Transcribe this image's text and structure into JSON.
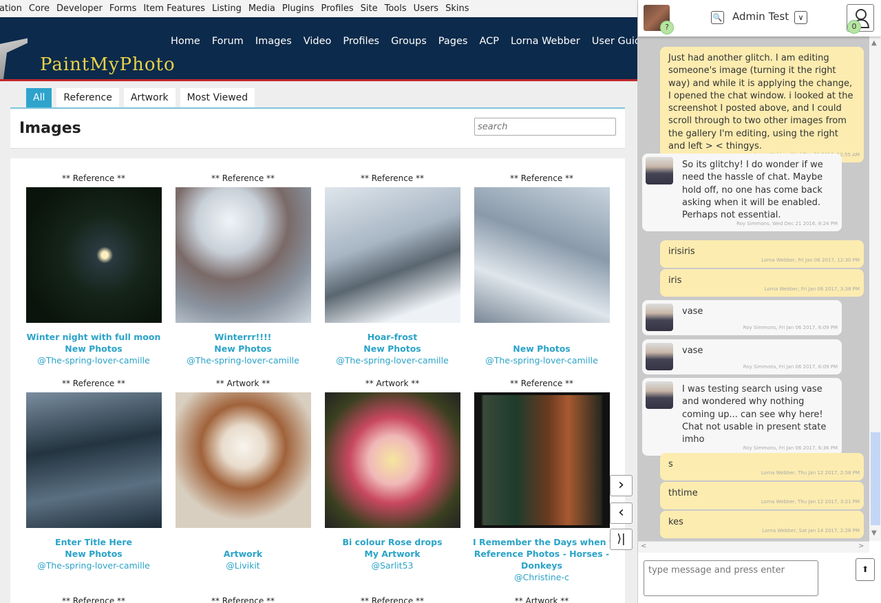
{
  "admin_bar": [
    "ation",
    "Core",
    "Developer",
    "Forms",
    "Item Features",
    "Listing",
    "Media",
    "Plugins",
    "Profiles",
    "Site",
    "Tools",
    "Users",
    "Skins"
  ],
  "site": {
    "logo": "PaintMyPhoto",
    "nav": [
      "Home",
      "Forum",
      "Images",
      "Video",
      "Profiles",
      "Groups",
      "Pages",
      "ACP",
      "Lorna Webber",
      "User Guides"
    ]
  },
  "tabs": [
    "All",
    "Reference",
    "Artwork",
    "Most Viewed"
  ],
  "page_title": "Images",
  "search_placeholder": "search",
  "images": [
    {
      "cat": "** Reference **",
      "title": "Winter night with full moon",
      "album": "New Photos",
      "user": "@The-spring-lover-camille"
    },
    {
      "cat": "** Reference **",
      "title": "Winterrr!!!!",
      "album": "New Photos",
      "user": "@The-spring-lover-camille"
    },
    {
      "cat": "** Reference **",
      "title": "Hoar-frost",
      "album": "New Photos",
      "user": "@The-spring-lover-camille"
    },
    {
      "cat": "** Reference **",
      "title": "",
      "album": "New Photos",
      "user": "@The-spring-lover-camille"
    },
    {
      "cat": "** Reference **",
      "title": "Enter Title Here",
      "album": "New Photos",
      "user": "@The-spring-lover-camille"
    },
    {
      "cat": "** Artwork **",
      "title": "",
      "album": "Artwork",
      "user": "@Livikit"
    },
    {
      "cat": "** Artwork **",
      "title": "Bi colour Rose drops",
      "album": "My Artwork",
      "user": "@Sarlit53"
    },
    {
      "cat": "** Reference **",
      "title": "I Remember the Days when we...",
      "album": "Reference Photos - Horses - Donkeys",
      "user": "@Christine-c"
    },
    {
      "cat": "** Reference **"
    },
    {
      "cat": "** Reference **"
    },
    {
      "cat": "** Reference **"
    },
    {
      "cat": "** Artwork **"
    }
  ],
  "lightbox_nav": {
    "next": "›",
    "prev": "‹",
    "last": "⟩|"
  },
  "chat": {
    "user": "Admin Test",
    "my_badge": "?",
    "online_count": "0",
    "messages": [
      {
        "side": "me",
        "text": "Just had another glitch. I am editing someone's image (turning it the right way) and while it is applying the change, I opened the chat window. i looked at the screenshot I posted above, and I could scroll through to two other images from the gallery I'm editing, using the right and left > < thingys.",
        "ts": "Lorna Webber, Wed Dec 21 2016, 12:55 AM"
      },
      {
        "side": "other",
        "text": "So its glitchy! I do wonder if we need the hassle of chat. Maybe hold off, no one has come back asking when it will be enabled. Perhaps not essential.",
        "ts": "Roy Simmons, Wed Dec 21 2016, 8:24 PM"
      },
      {
        "side": "me",
        "text": "irisiris",
        "ts": "Lorna Webber, Fri Jan 06 2017, 12:30 PM"
      },
      {
        "side": "me",
        "text": "iris",
        "ts": "Lorna Webber, Fri Jan 06 2017, 3:38 PM"
      },
      {
        "side": "other",
        "text": "vase",
        "ts": "Roy Simmons, Fri Jan 06 2017, 6:09 PM"
      },
      {
        "side": "other",
        "text": "vase",
        "ts": "Roy Simmons, Fri Jan 06 2017, 6:09 PM"
      },
      {
        "side": "other",
        "text": "I was testing search using vase and wondered why nothing coming up... can see why here! Chat not usable in present state imho",
        "ts": "Roy Simmons, Fri Jan 06 2017, 6:36 PM"
      },
      {
        "side": "me",
        "text": "s",
        "ts": "Lorna Webber, Thu Jan 12 2017, 2:58 PM"
      },
      {
        "side": "me",
        "text": "thtime",
        "ts": "Lorna Webber, Thu Jan 12 2017, 3:21 PM"
      },
      {
        "side": "me",
        "text": "kes",
        "ts": "Lorna Webber, Sat Jan 14 2017, 2:28 PM"
      }
    ],
    "input_placeholder": "type message and press enter"
  }
}
